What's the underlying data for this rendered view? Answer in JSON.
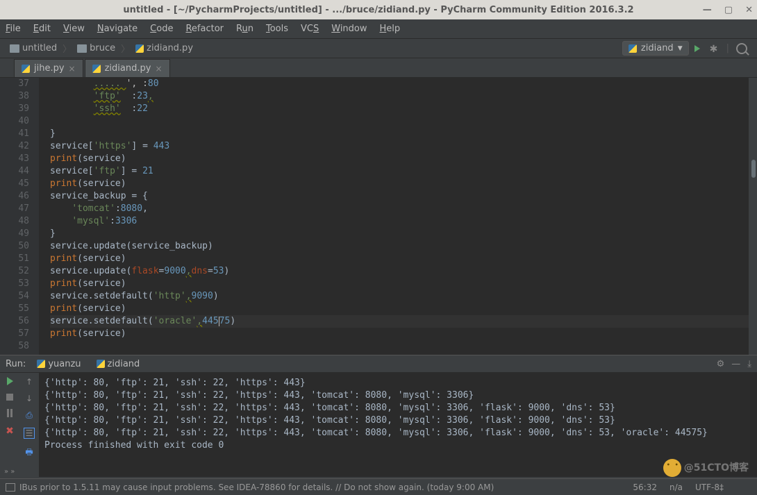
{
  "title": "untitled - [~/PycharmProjects/untitled] - .../bruce/zidiand.py - PyCharm Community Edition 2016.3.2",
  "menu": [
    "File",
    "Edit",
    "View",
    "Navigate",
    "Code",
    "Refactor",
    "Run",
    "Tools",
    "VCS",
    "Window",
    "Help"
  ],
  "breadcrumbs": [
    {
      "icon": "folder",
      "label": "untitled"
    },
    {
      "icon": "folder",
      "label": "bruce"
    },
    {
      "icon": "py",
      "label": "zidiand.py"
    }
  ],
  "run_config": "zidiand",
  "tabs": [
    {
      "label": "jihe.py",
      "active": false
    },
    {
      "label": "zidiand.py",
      "active": true
    }
  ],
  "lines": [
    37,
    38,
    39,
    40,
    41,
    42,
    43,
    44,
    45,
    46,
    47,
    48,
    49,
    50,
    51,
    52,
    53,
    54,
    55,
    56,
    57,
    58
  ],
  "code": {
    "37": {
      "indent": "        ",
      "ftp_trail": "', :",
      "ftp_n": "80"
    },
    "38": {
      "indent": "        ",
      "str": "'ftp'",
      "colon": "  :",
      "num": "23"
    },
    "39": {
      "indent": "        ",
      "str": "'ssh'",
      "colon": "  :",
      "num": "22"
    },
    "41": {
      "brace": "}"
    },
    "42": {
      "pre": "service[",
      "str": "'https'",
      "mid": "] = ",
      "num": "443"
    },
    "43": {
      "fn": "print",
      "arg": "(service)"
    },
    "44": {
      "pre": "service[",
      "str": "'ftp'",
      "mid": "] = ",
      "num": "21"
    },
    "45": {
      "fn": "print",
      "arg": "(service)"
    },
    "46": {
      "id": "service_backup = {"
    },
    "47": {
      "indent": "    ",
      "str": "'tomcat'",
      "colon": ":",
      "num": "8080",
      "comma": ","
    },
    "48": {
      "indent": "    ",
      "str": "'mysql'",
      "colon": ":",
      "num": "3306"
    },
    "49": {
      "brace": "}"
    },
    "50": {
      "id": "service.update(service_backup)"
    },
    "51": {
      "fn": "print",
      "arg": "(service)"
    },
    "52": {
      "pre": "service.update(",
      "kw1": "flask",
      "eq1": "=",
      "n1": "9000",
      "sep": ",",
      "kw2": "dns",
      "eq2": "=",
      "n2": "53",
      "post": ")"
    },
    "53": {
      "fn": "print",
      "arg": "(service)"
    },
    "54": {
      "pre": "service.setdefault(",
      "str": "'http'",
      "sep": ",",
      "num": "9090",
      "post": ")"
    },
    "55": {
      "fn": "print",
      "arg": "(service)"
    },
    "56": {
      "pre": "service.setdefault(",
      "str": "'oracle'",
      "sep": ",",
      "num": "44575",
      "post": ")"
    },
    "57": {
      "fn": "print",
      "arg": "(service)"
    }
  },
  "run_panel": {
    "label": "Run:",
    "tabs": [
      {
        "label": "yuanzu"
      },
      {
        "label": "zidiand"
      }
    ]
  },
  "console": [
    "{'http': 80, 'ftp': 21, 'ssh': 22, 'https': 443}",
    "{'http': 80, 'ftp': 21, 'ssh': 22, 'https': 443, 'tomcat': 8080, 'mysql': 3306}",
    "{'http': 80, 'ftp': 21, 'ssh': 22, 'https': 443, 'tomcat': 8080, 'mysql': 3306, 'flask': 9000, 'dns': 53}",
    "{'http': 80, 'ftp': 21, 'ssh': 22, 'https': 443, 'tomcat': 8080, 'mysql': 3306, 'flask': 9000, 'dns': 53}",
    "{'http': 80, 'ftp': 21, 'ssh': 22, 'https': 443, 'tomcat': 8080, 'mysql': 3306, 'flask': 9000, 'dns': 53, 'oracle': 44575}",
    "",
    "Process finished with exit code 0"
  ],
  "status": {
    "msg": "IBus prior to 1.5.11 may cause input problems. See IDEA-78860 for details. // Do not show again. (today 9:00 AM)",
    "pos": "56:32",
    "na": "n/a",
    "enc": "UTF-8‡"
  },
  "watermark": "@51CTO博客"
}
